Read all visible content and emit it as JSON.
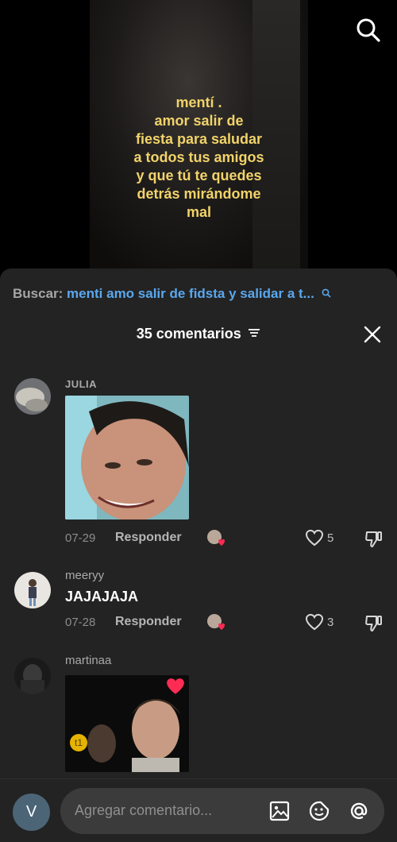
{
  "video": {
    "caption_lines": [
      "mentí .",
      "amor salir de",
      "fiesta para saludar",
      "a todos tus amigos",
      "y que tú te quedes",
      "detrás mirándome",
      "mal"
    ]
  },
  "icons": {
    "top_search": "search-icon",
    "close": "close-icon",
    "filter": "filter-icon",
    "heart": "heart-icon",
    "dislike": "thumbs-down-icon",
    "image": "image-icon",
    "sticker": "emoji-icon",
    "mention": "at-icon"
  },
  "sheet": {
    "search_label": "Buscar:",
    "search_query": "menti amo salir de fidsta y salidar a t...",
    "comment_count_label": "35 comentarios"
  },
  "comments": [
    {
      "username": "JULIA",
      "date": "07-29",
      "reply_label": "Responder",
      "likes": "5"
    },
    {
      "username": "meeryy",
      "text": "JAJAJAJA",
      "date": "07-28",
      "reply_label": "Responder",
      "likes": "3"
    },
    {
      "username": "martinaa",
      "media_badge": "t1"
    }
  ],
  "composer": {
    "user_initial": "V",
    "placeholder": "Agregar comentario..."
  },
  "colors": {
    "accent_link": "#5aa8ee",
    "caption": "#f2d36a",
    "sheet_bg": "#232323",
    "heart_red": "#fe2c55"
  }
}
